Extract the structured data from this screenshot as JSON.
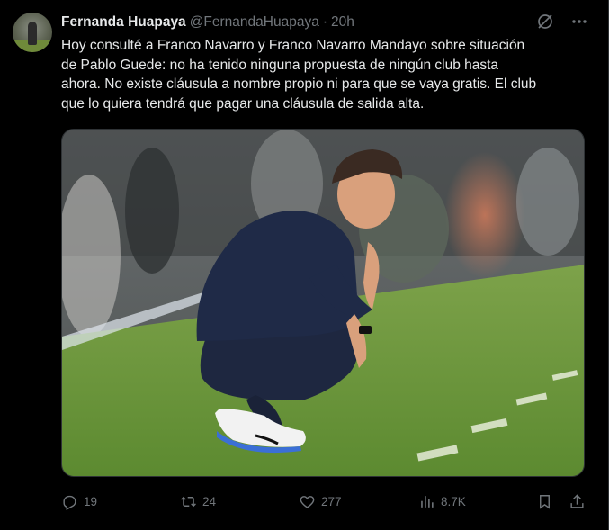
{
  "tweet": {
    "author": {
      "name": "Fernanda Huapaya",
      "handle": "@FernandaHuapaya",
      "separator": "·",
      "time": "20h"
    },
    "text": "Hoy consulté a Franco Navarro y Franco Navarro Mandayo sobre situación\nde Pablo Guede: no ha tenido ninguna propuesta de ningún club hasta\nahora. No existe cláusula a nombre propio ni para que se vaya gratis. El club\nque lo quiera tendrá que pagar una cláusula de salida alta.",
    "header_icons": [
      "grok-icon",
      "more-icon"
    ],
    "media": {
      "type": "photo",
      "icon": "photo-of-crouching-coach"
    },
    "actions": {
      "reply": {
        "icon": "reply-icon",
        "count": "19"
      },
      "retweet": {
        "icon": "retweet-icon",
        "count": "24"
      },
      "like": {
        "icon": "heart-icon",
        "count": "277"
      },
      "views": {
        "icon": "analytics-icon",
        "count": "8.7K"
      },
      "bookmark": {
        "icon": "bookmark-icon"
      },
      "share": {
        "icon": "share-icon"
      }
    }
  },
  "colors": {
    "background": "#000000",
    "text": "#e7e9ea",
    "secondary": "#71767b",
    "border": "#2f3336"
  }
}
